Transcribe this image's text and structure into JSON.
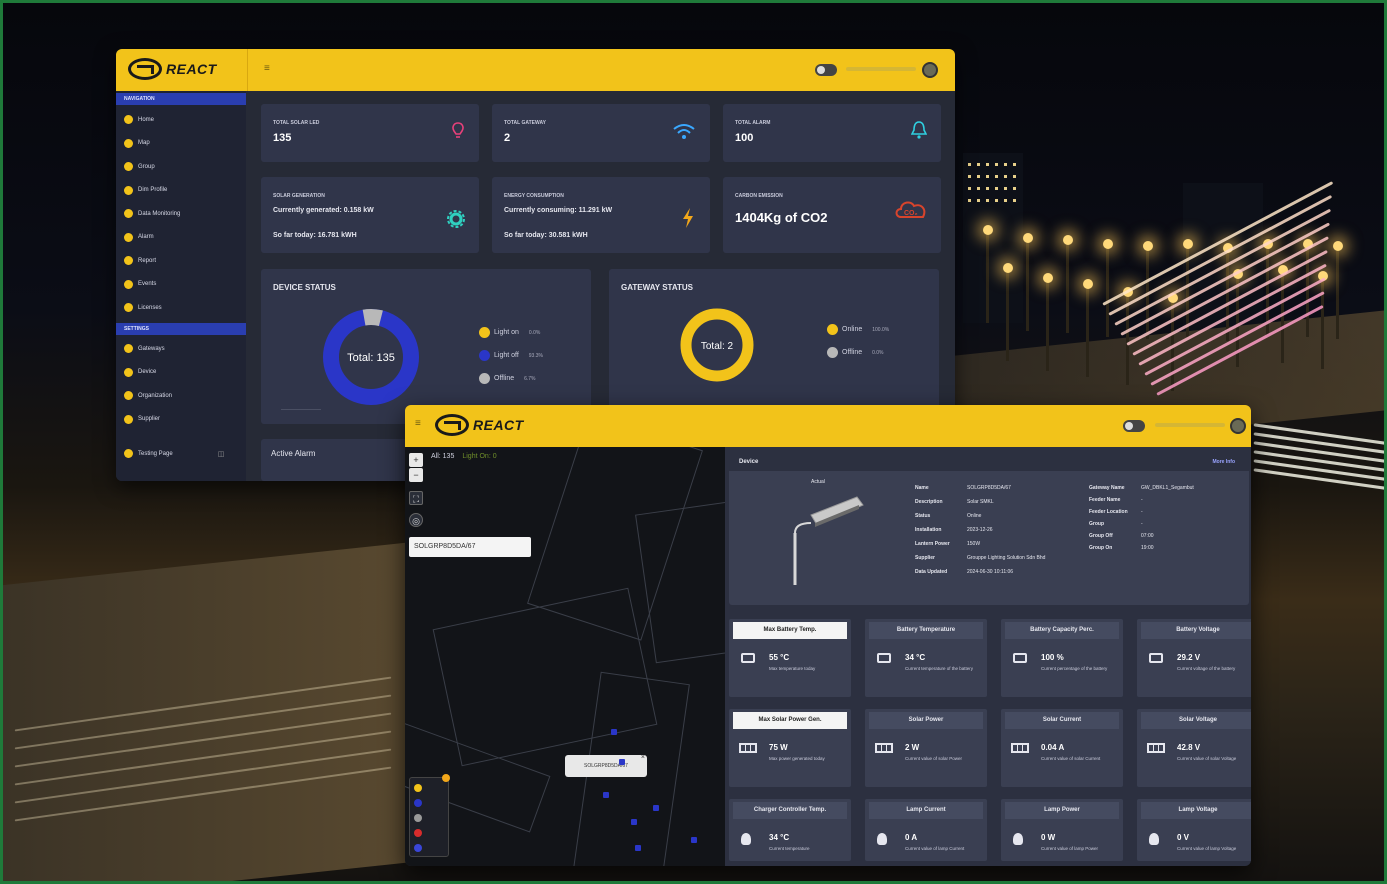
{
  "brand": "REACT",
  "dashboard": {
    "sidebar": {
      "navigation_header": "NAVIGATION",
      "nav_items": [
        "Home",
        "Map",
        "Group",
        "Dim Profile",
        "Data Monitoring",
        "Alarm",
        "Report",
        "Events",
        "Licenses"
      ],
      "settings_header": "SETTINGS",
      "settings_items": [
        "Gateways",
        "Device",
        "Organization",
        "Supplier"
      ],
      "testing_page": "Testing Page"
    },
    "stats": {
      "total_solar_led": {
        "label": "TOTAL SOLAR LED",
        "value": "135"
      },
      "total_gateway": {
        "label": "TOTAL GATEWAY",
        "value": "2"
      },
      "total_alarm": {
        "label": "TOTAL ALARM",
        "value": "100"
      }
    },
    "solar_generation": {
      "label": "SOLAR GENERATION",
      "line1": "Currently generated: 0.158 kW",
      "line2": "So far today: 16.781 kWH"
    },
    "energy_consumption": {
      "label": "ENERGY CONSUMPTION",
      "line1": "Currently consuming: 11.291 kW",
      "line2": "So far today: 30.581 kWH"
    },
    "carbon_emission": {
      "label": "CARBON EMISSION",
      "value": "1404Kg of CO2"
    },
    "device_status": {
      "title": "DEVICE STATUS",
      "center": "Total: 135",
      "legend": [
        {
          "label": "Light on",
          "pct": "0.0%",
          "color": "#f2c31a"
        },
        {
          "label": "Light off",
          "pct": "93.3%",
          "color": "#2a36c8"
        },
        {
          "label": "Offline",
          "pct": "6.7%",
          "color": "#b8b8b8"
        }
      ]
    },
    "gateway_status": {
      "title": "GATEWAY STATUS",
      "center": "Total: 2",
      "legend": [
        {
          "label": "Online",
          "pct": "100.0%",
          "color": "#f2c31a"
        },
        {
          "label": "Offline",
          "pct": "0.0%",
          "color": "#b8b8b8"
        }
      ]
    },
    "active_alarm": "Active Alarm"
  },
  "device_view": {
    "map": {
      "filter_all": "All: 135",
      "filter_light_on": "Light On: 0",
      "search_value": "SOLGRP8D5DA/67",
      "popup_label": "SOLGRP8D5DA/67"
    },
    "device_panel": {
      "title": "Device",
      "more_info": "More Info",
      "image_caption": "Actual",
      "fields": [
        {
          "k": "Name",
          "v": "SOLGRP8D5DA/67"
        },
        {
          "k": "Description",
          "v": "Solar SMKL"
        },
        {
          "k": "Status",
          "v": "Online"
        },
        {
          "k": "Installation",
          "v": "2023-12-26"
        },
        {
          "k": "Lantern Power",
          "v": "150W"
        },
        {
          "k": "Supplier",
          "v": "Grouppe Lighting Solution Sdn Bhd"
        },
        {
          "k": "Data Updated",
          "v": "2024-06-30 10:11:06"
        }
      ],
      "fields_right": [
        {
          "k": "Gateway Name",
          "v": "GW_DBKL1_Segambut"
        },
        {
          "k": "Feeder Name",
          "v": "-"
        },
        {
          "k": "Feeder Location",
          "v": "-"
        },
        {
          "k": "Group",
          "v": "-"
        },
        {
          "k": "Group Off",
          "v": "07:00"
        },
        {
          "k": "Group On",
          "v": "19:00"
        }
      ]
    },
    "metrics": [
      {
        "title": "Max Battery Temp.",
        "value": "55 °C",
        "desc": "Max temperature today",
        "light": true
      },
      {
        "title": "Battery Temperature",
        "value": "34 °C",
        "desc": "Current temperature of the battery",
        "light": false
      },
      {
        "title": "Battery Capacity Perc.",
        "value": "100 %",
        "desc": "Current percentage of the battery",
        "light": false
      },
      {
        "title": "Battery Voltage",
        "value": "29.2 V",
        "desc": "Current voltage of the battery",
        "light": false
      },
      {
        "title": "Max Solar Power Gen.",
        "value": "75 W",
        "desc": "Max power generated today",
        "light": true
      },
      {
        "title": "Solar Power",
        "value": "2 W",
        "desc": "Current value of solar Power",
        "light": false
      },
      {
        "title": "Solar Current",
        "value": "0.04 A",
        "desc": "Current value of solar Current",
        "light": false
      },
      {
        "title": "Solar Voltage",
        "value": "42.8 V",
        "desc": "Current value of solar Voltage",
        "light": false
      },
      {
        "title": "Charger Controller Temp.",
        "value": "34 °C",
        "desc": "Current temperature",
        "light": false
      },
      {
        "title": "Lamp Current",
        "value": "0 A",
        "desc": "Current value of lamp Current",
        "light": false
      },
      {
        "title": "Lamp Power",
        "value": "0 W",
        "desc": "Current value of lamp Power",
        "light": false
      },
      {
        "title": "Lamp Voltage",
        "value": "0 V",
        "desc": "Current value of lamp Voltage",
        "light": false
      }
    ]
  }
}
